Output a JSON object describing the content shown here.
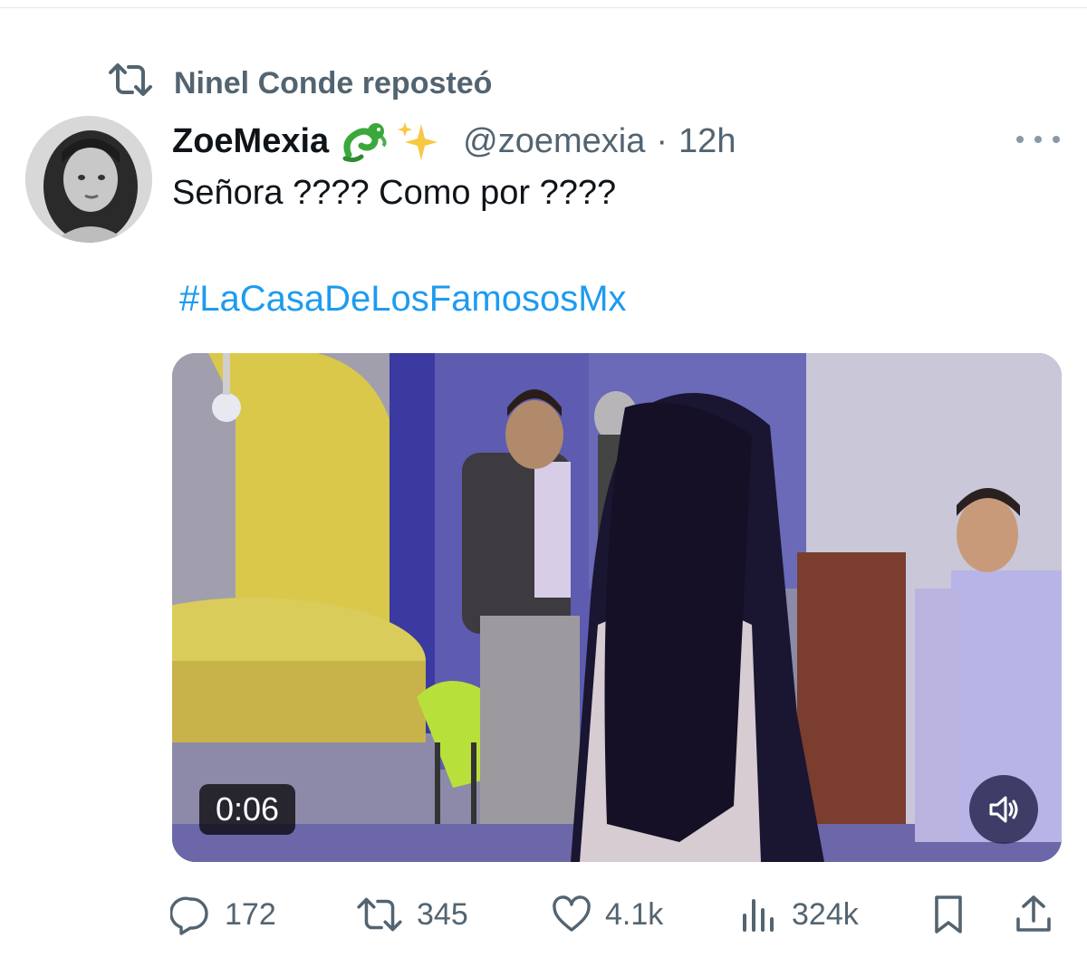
{
  "repost": {
    "text": "Ninel Conde reposteó",
    "icon": "repost-icon"
  },
  "tweet": {
    "display_name": "ZoeMexia",
    "name_emojis": [
      "dragon-emoji",
      "sparkles-emoji"
    ],
    "handle": "@zoemexia",
    "separator": "·",
    "time": "12h",
    "text": "Señora ???? Como por ????",
    "hashtag": "#LaCasaDeLosFamososMx"
  },
  "media": {
    "duration": "0:06",
    "mute_icon": "speaker-muted-icon"
  },
  "actions": {
    "replies": "172",
    "reposts": "345",
    "likes": "4.1k",
    "views": "324k"
  },
  "colors": {
    "text": "#0f1419",
    "secondary": "#536471",
    "link": "#1d9bf0"
  }
}
